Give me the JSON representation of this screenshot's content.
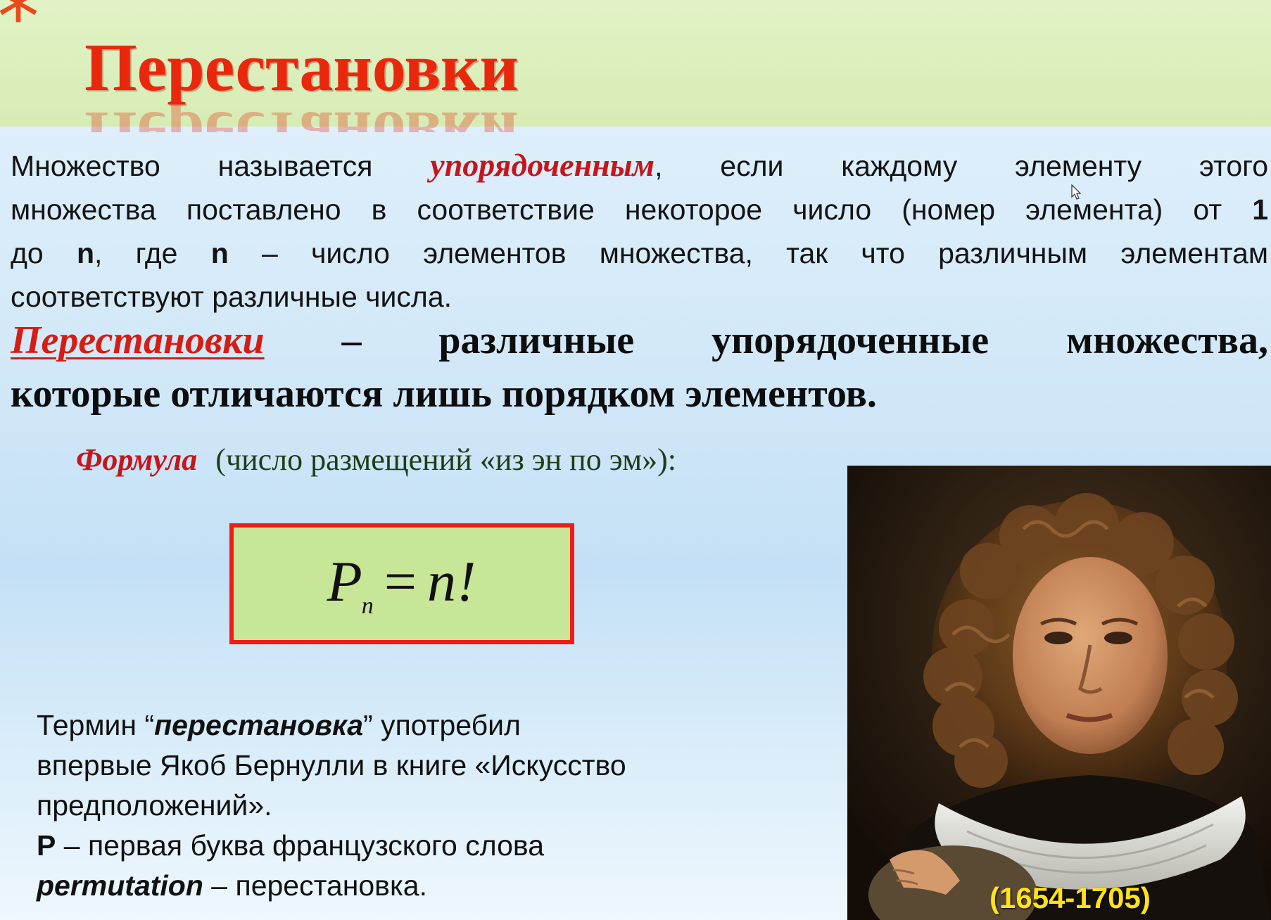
{
  "slide": {
    "title": "Перестановки",
    "definition": {
      "l1_a": "Множество называется ",
      "l1_hl": "упорядоченным",
      "l1_b": ", если каждому элементу этого",
      "l2_a": "множества поставлено в соответствие некоторое число  (номер элемента) от ",
      "l2_num": "1",
      "l3_a": "до ",
      "l3_n1": "n",
      "l3_b": ", где ",
      "l3_n2": "n",
      "l3_c": " – число элементов множества, так что различным элементам",
      "l4": "соответствуют различные числа."
    },
    "perm_def": {
      "term": "Перестановки",
      "l1_rest": " – различные упорядоченные множества,",
      "l2": "которые отличаются лишь порядком элементов."
    },
    "formula": {
      "label": "Формула",
      "caption": "(число размещений «из эн по эм»):",
      "lhs": "P",
      "sub": "n",
      "eq": "=",
      "rhs": "n!"
    },
    "note": {
      "l1_a": "Термин “",
      "l1_term": "перестановка",
      "l1_b": "” употребил",
      "l2": "впервые Якоб Бернулли в книге «Искусство",
      "l3": "предположений».",
      "l4_p": "P",
      "l4_rest": " – первая буква французского слова",
      "l5_word": "permutation",
      "l5_rest": " – перестановка."
    },
    "portrait": {
      "years": "(1654-1705)"
    }
  },
  "colors": {
    "accent_red": "#e8270c",
    "header_green": "#d6ecb4",
    "formula_box": "#c8e698",
    "years_yellow": "#ffe21a"
  }
}
